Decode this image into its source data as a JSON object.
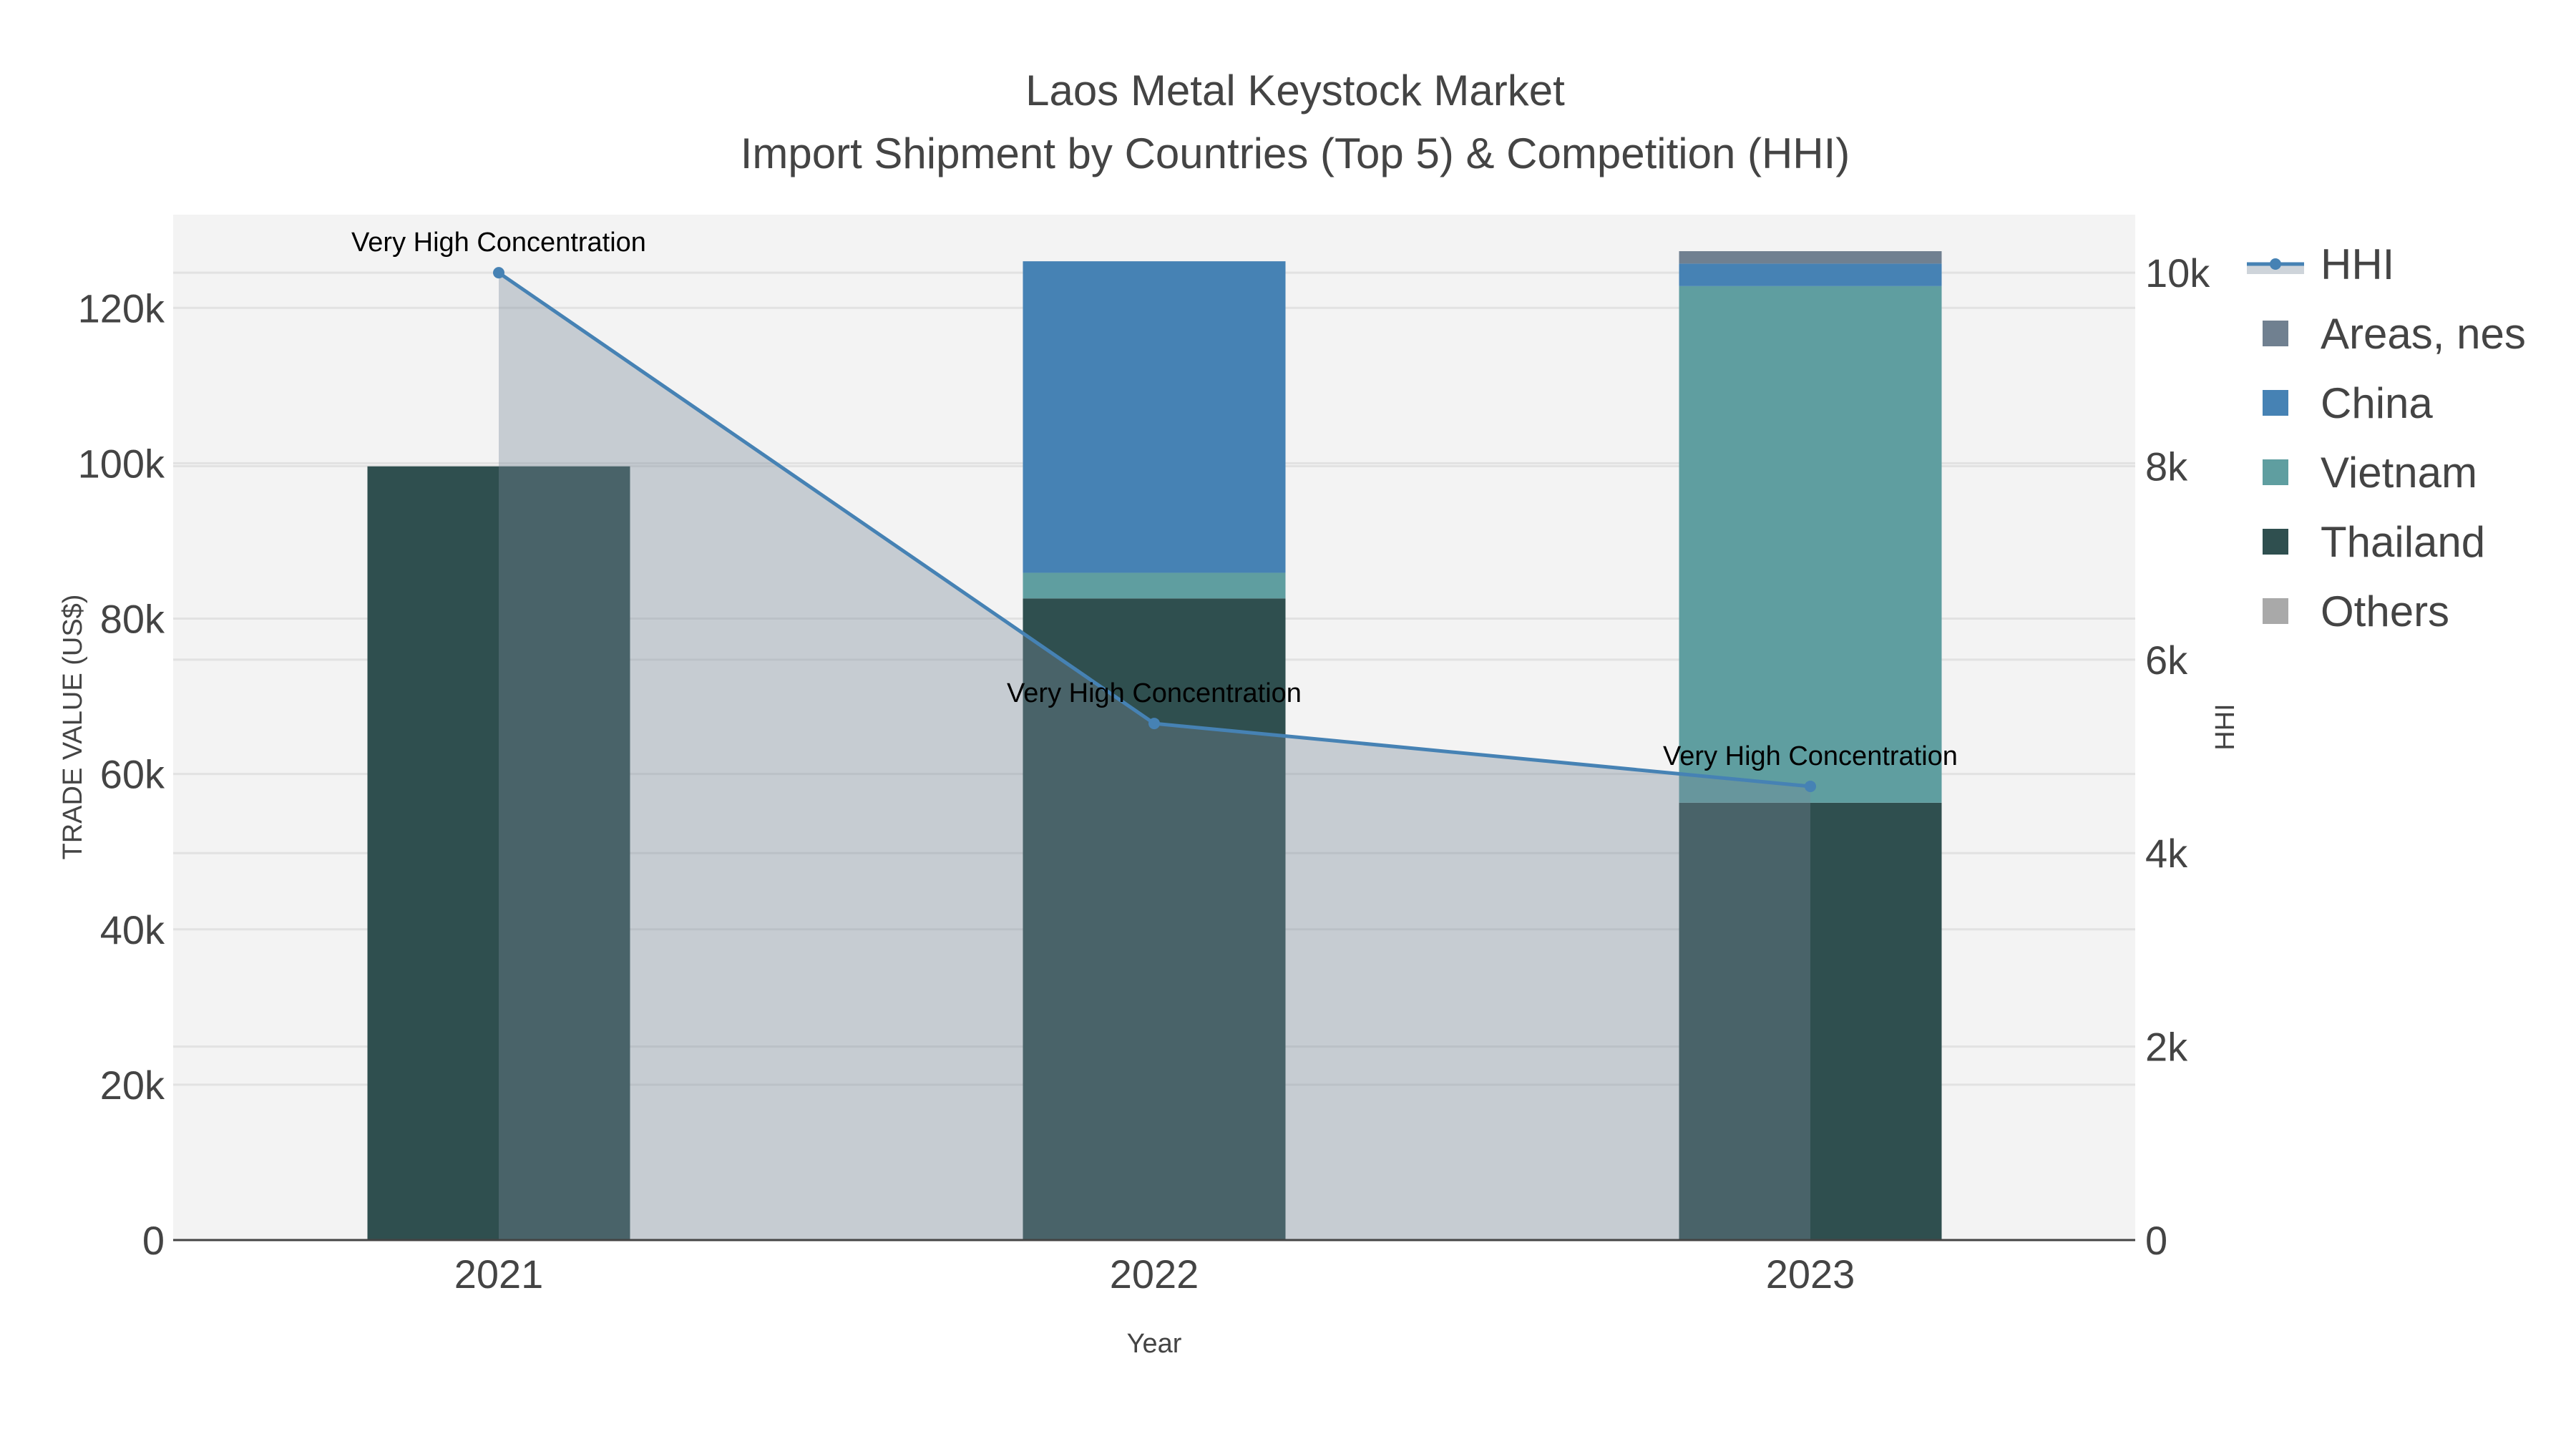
{
  "chart_data": {
    "type": "bar",
    "title": "Laos Metal Keystock Market",
    "subtitle": "Import Shipment by Countries (Top 5) & Competition (HHI)",
    "xlabel": "Year",
    "ylabel": "TRADE VALUE (US$)",
    "y2label": "HHI",
    "categories": [
      "2021",
      "2022",
      "2023"
    ],
    "ylim": [
      0,
      132000
    ],
    "y2lim": [
      0,
      10600
    ],
    "yticks": [
      0,
      20000,
      40000,
      60000,
      80000,
      100000,
      120000
    ],
    "ytick_labels": [
      "0",
      "20k",
      "40k",
      "60k",
      "80k",
      "100k",
      "120k"
    ],
    "y2ticks": [
      0,
      2000,
      4000,
      6000,
      8000,
      10000
    ],
    "y2tick_labels": [
      "0",
      "2k",
      "4k",
      "6k",
      "8k",
      "10k"
    ],
    "barmode": "stack",
    "series": [
      {
        "name": "Thailand",
        "color": "#2F4F4F",
        "values": [
          99600,
          82600,
          56300
        ]
      },
      {
        "name": "Vietnam",
        "color": "#5F9EA0",
        "values": [
          0,
          3300,
          66500
        ]
      },
      {
        "name": "China",
        "color": "#4682B4",
        "values": [
          0,
          40100,
          2900
        ]
      },
      {
        "name": "Areas, nes",
        "color": "#708090",
        "values": [
          0,
          0,
          1600
        ]
      },
      {
        "name": "Others",
        "color": "#A9A9A9",
        "values": [
          0,
          0,
          0
        ]
      }
    ],
    "line": {
      "name": "HHI",
      "axis": "y2",
      "color": "#4682B4",
      "fill": "tozeroy",
      "values": [
        10000,
        5340,
        4690
      ]
    },
    "annotations": [
      "Very High Concentration",
      "Very High Concentration",
      "Very High Concentration"
    ],
    "legend_order": [
      "HHI",
      "Areas, nes",
      "China",
      "Vietnam",
      "Thailand",
      "Others"
    ],
    "legend_position": "right",
    "grid": true
  }
}
